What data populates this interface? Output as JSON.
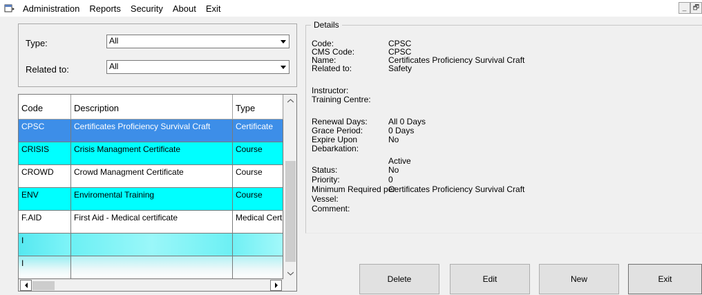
{
  "menu": [
    "Administration",
    "Reports",
    "Security",
    "About",
    "Exit"
  ],
  "window_controls": [
    "_",
    "🗗"
  ],
  "filters": {
    "type_label": "Type:",
    "type_value": "All",
    "related_label": "Related to:",
    "related_value": "All"
  },
  "grid": {
    "columns": [
      "Code",
      "Description",
      "Type"
    ],
    "rows": [
      {
        "code": "CPSC",
        "description": "Certificates Proficiency Survival Craft",
        "type": "Certificate"
      },
      {
        "code": "CRISIS",
        "description": "Crisis Managment Certificate",
        "type": "Course"
      },
      {
        "code": "CROWD",
        "description": "Crowd Managment Certificate",
        "type": "Course"
      },
      {
        "code": "ENV",
        "description": "Enviromental Training",
        "type": "Course"
      },
      {
        "code": "F.AID",
        "description": "First Aid - Medical certificate",
        "type": "Medical Certi"
      }
    ],
    "partial_rows": [
      "I",
      "I"
    ]
  },
  "details": {
    "legend": "Details",
    "code_label": "Code:",
    "code_value": "CPSC",
    "cms_label": "CMS Code:",
    "cms_value": "CPSC",
    "name_label": "Name:",
    "name_value": "Certificates Proficiency Survival Craft",
    "related_label": "Related to:",
    "related_value": "Safety",
    "instructor_label": "Instructor:",
    "training_label": "Training Centre:",
    "renewal_label": "Renewal Days:",
    "renewal_value": "All 0 Days",
    "grace_label": "Grace Period:",
    "grace_value": "0 Days",
    "expire_label": "Expire Upon",
    "expire_value": "No",
    "debark_label": "Debarkation:",
    "active_value": "Active",
    "status_label": "Status:",
    "status_value": "No",
    "priority_label": "Priority:",
    "priority_value": "0",
    "min_label": "Minimum Required per",
    "min_value": "Certificates Proficiency Survival Craft",
    "vessel_label": "Vessel:",
    "comment_label": "Comment:"
  },
  "buttons": {
    "delete": "Delete",
    "edit": "Edit",
    "new": "New",
    "exit": "Exit"
  },
  "colors": {
    "selected_row": "#3d8ee8",
    "highlight_row": "#00ffff",
    "background": "#f0f0f0"
  }
}
